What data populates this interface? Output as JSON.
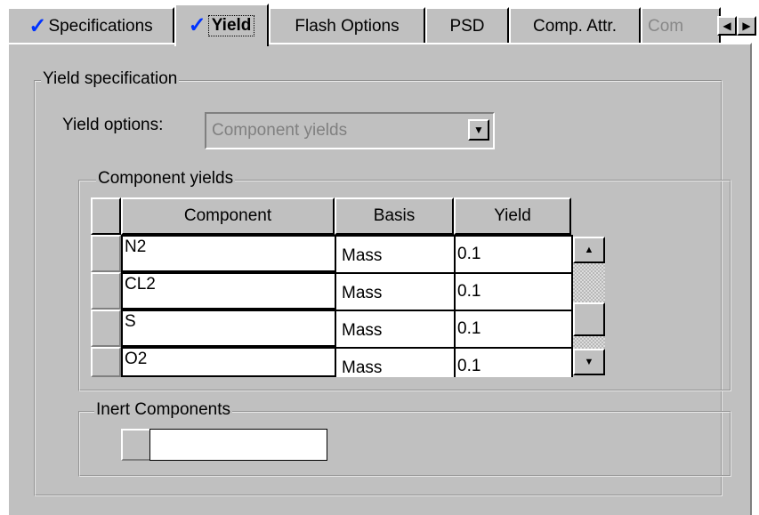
{
  "tabs": [
    {
      "label": "Specifications",
      "checked": true
    },
    {
      "label": "Yield",
      "checked": true
    },
    {
      "label": "Flash Options",
      "checked": false
    },
    {
      "label": "PSD",
      "checked": false
    },
    {
      "label": "Comp. Attr.",
      "checked": false
    },
    {
      "label": "Com",
      "checked": false
    }
  ],
  "check_mark": "✓",
  "yield_spec": {
    "legend": "Yield specification",
    "options_label": "Yield options:",
    "options_value": "Component yields"
  },
  "component_yields": {
    "legend": "Component yields",
    "columns": [
      "Component",
      "Basis",
      "Yield"
    ],
    "rows": [
      {
        "component": "N2",
        "basis": "Mass",
        "yield": "0.1"
      },
      {
        "component": "CL2",
        "basis": "Mass",
        "yield": "0.1"
      },
      {
        "component": "S",
        "basis": "Mass",
        "yield": "0.1"
      },
      {
        "component": "O2",
        "basis": "Mass",
        "yield": "0.1"
      }
    ]
  },
  "inert": {
    "legend": "Inert Components"
  }
}
